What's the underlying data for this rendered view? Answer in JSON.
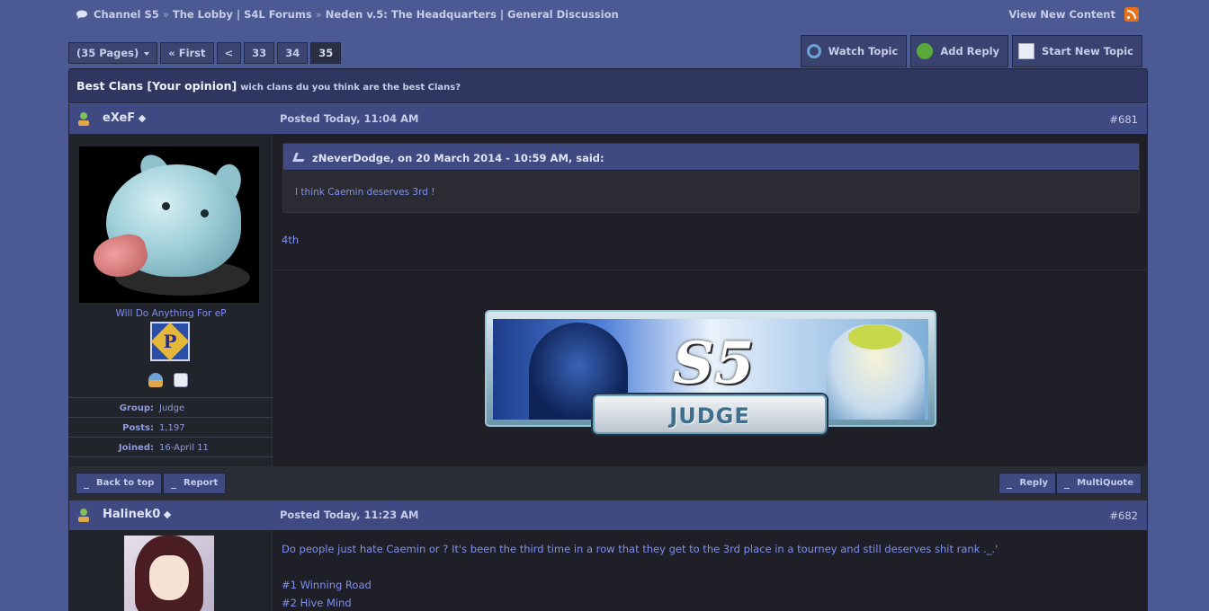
{
  "breadcrumb": {
    "items": [
      "Channel S5",
      "The Lobby | S4L Forums",
      "Neden v.5: The Headquarters | General Discussion"
    ],
    "separator": "»"
  },
  "topright": {
    "view_new": "View New Content"
  },
  "pagination": {
    "pages_label": "(35 Pages)",
    "first": "« First",
    "prev": "<",
    "pages": [
      "33",
      "34",
      "35"
    ],
    "current": "35"
  },
  "actions": {
    "watch": "Watch Topic",
    "add_reply": "Add Reply",
    "start_new": "Start New Topic"
  },
  "topic": {
    "title": "Best Clans [Your opinion]",
    "description": "wich clans du you think are the best Clans?"
  },
  "post1": {
    "author": "eXeF",
    "posted": "Posted Today, 11:04 AM",
    "number": "#681",
    "user_title": "Will Do Anything For eP",
    "rank_letter": "P",
    "info": [
      {
        "key": "Group:",
        "value": "Judge"
      },
      {
        "key": "Posts:",
        "value": "1,197"
      },
      {
        "key": "Joined:",
        "value": "16-April 11"
      }
    ],
    "quote_header": "zNeverDodge, on 20 March 2014 - 10:59 AM, said:",
    "quote_text": "I think Caemin deserves 3rd !",
    "text": "4th",
    "signature": {
      "logo": "S5",
      "plate": "JUDGE"
    }
  },
  "footer": {
    "back_to_top": "Back to top",
    "report": "Report",
    "reply": "Reply",
    "multiquote": "MultiQuote"
  },
  "post2": {
    "author": "Halinek0",
    "posted": "Posted Today, 11:23 AM",
    "number": "#682",
    "line1": "Do people just hate Caemin or ? It's been the third time in a row that they get to the 3rd place in a tourney and still deserves shit rank ._.'",
    "line2": "#1 Winning Road",
    "line3": "#2 Hive Mind"
  },
  "colors": {
    "page_bg": "#4c5a94",
    "header_bg": "#3f4a82",
    "body_bg": "#1f2027",
    "link_text": "#7f8ff0",
    "rss": "#e8731d"
  }
}
